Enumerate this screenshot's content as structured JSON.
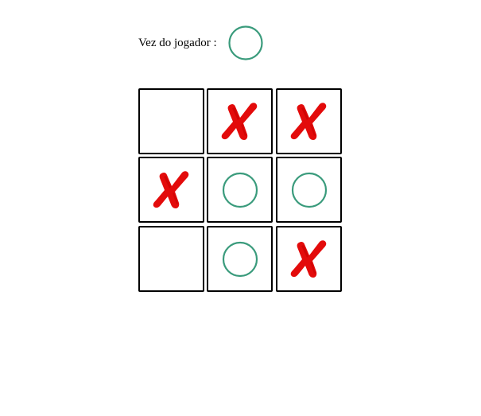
{
  "turn": {
    "label": "Vez do jogador :",
    "current_player": "O"
  },
  "board": {
    "cells": [
      "",
      "X",
      "X",
      "X",
      "O",
      "O",
      "",
      "O",
      "X"
    ]
  },
  "colors": {
    "o_stroke": "#3a9b7c",
    "x_fill": "#e30b0b",
    "cell_border": "#000000"
  },
  "icons": {
    "o": "circle-o-icon",
    "x": "cross-x-icon"
  }
}
